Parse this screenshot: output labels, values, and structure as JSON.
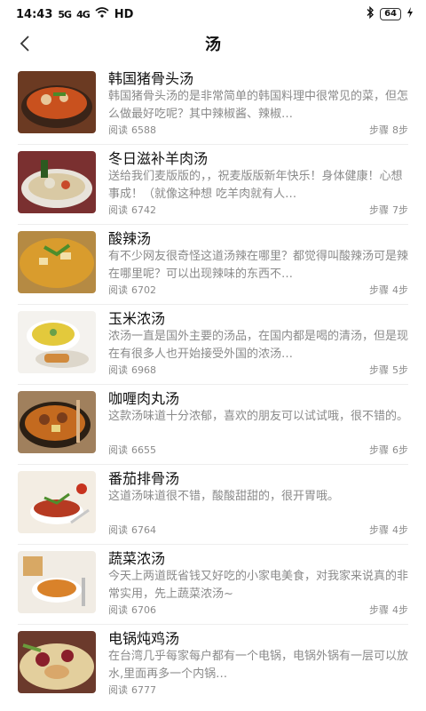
{
  "status_bar": {
    "time": "14:43",
    "signal_1": "5G",
    "signal_2": "4G",
    "wifi_label": "HD",
    "battery": "64"
  },
  "header": {
    "title": "汤"
  },
  "read_label": "阅读",
  "steps_label": "步骤",
  "recipes": [
    {
      "title": "韩国猪骨头汤",
      "desc": "韩国猪骨头汤的是非常简单的韩国料理中很常见的菜，但怎么做最好吃呢？其中辣椒酱、辣椒…",
      "reads": "6588",
      "steps": "8步",
      "icon": "soup-bowl-icon"
    },
    {
      "title": "冬日滋补羊肉汤",
      "desc": "送给我们麦版版的，，祝麦版版新年快乐！身体健康！心想事成！（就像这种想 吃羊肉就有人…",
      "reads": "6742",
      "steps": "7步",
      "icon": "lamb-soup-icon"
    },
    {
      "title": "酸辣汤",
      "desc": "有不少网友很奇怪这道汤辣在哪里？都觉得叫酸辣汤可是辣在哪里呢？可以出现辣味的东西不…",
      "reads": "6702",
      "steps": "4步",
      "icon": "hot-sour-soup-icon"
    },
    {
      "title": "玉米浓汤",
      "desc": "浓汤一直是国外主要的汤品，在国内都是喝的清汤，但是现在有很多人也开始接受外国的浓汤…",
      "reads": "6968",
      "steps": "5步",
      "icon": "corn-soup-icon"
    },
    {
      "title": "咖喱肉丸汤",
      "desc": "这款汤味道十分浓郁，喜欢的朋友可以试试哦，很不错的。",
      "reads": "6655",
      "steps": "6步",
      "icon": "curry-meatball-soup-icon"
    },
    {
      "title": "番茄排骨汤",
      "desc": "这道汤味道很不错，酸酸甜甜的，很开胃哦。",
      "reads": "6764",
      "steps": "4步",
      "icon": "tomato-rib-soup-icon"
    },
    {
      "title": "蔬菜浓汤",
      "desc": "今天上两道既省钱又好吃的小家电美食，对我家来说真的非常实用，先上蔬菜浓汤~",
      "reads": "6706",
      "steps": "4步",
      "icon": "vegetable-soup-icon"
    },
    {
      "title": "电锅炖鸡汤",
      "desc": "在台湾几乎每家每户都有一个电锅，电锅外锅有一层可以放水,里面再多一个内锅…",
      "reads": "6777",
      "steps": "",
      "icon": "chicken-soup-icon"
    }
  ]
}
